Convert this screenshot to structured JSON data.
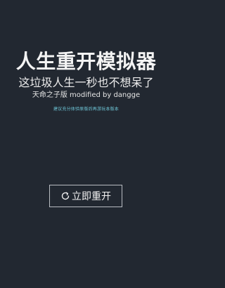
{
  "title": "人生重开模拟器",
  "subtitle": "这垃圾人生一秒也不想呆了",
  "credit": "天命之子版 modified by dangge",
  "notice": "建议充分体验原版后再游玩本版本",
  "restart_button": {
    "icon": "refresh-icon",
    "label": "立即重开"
  },
  "colors": {
    "background": "#222831",
    "notice": "#6fc7d8",
    "button_border": "#b8bcc2"
  }
}
